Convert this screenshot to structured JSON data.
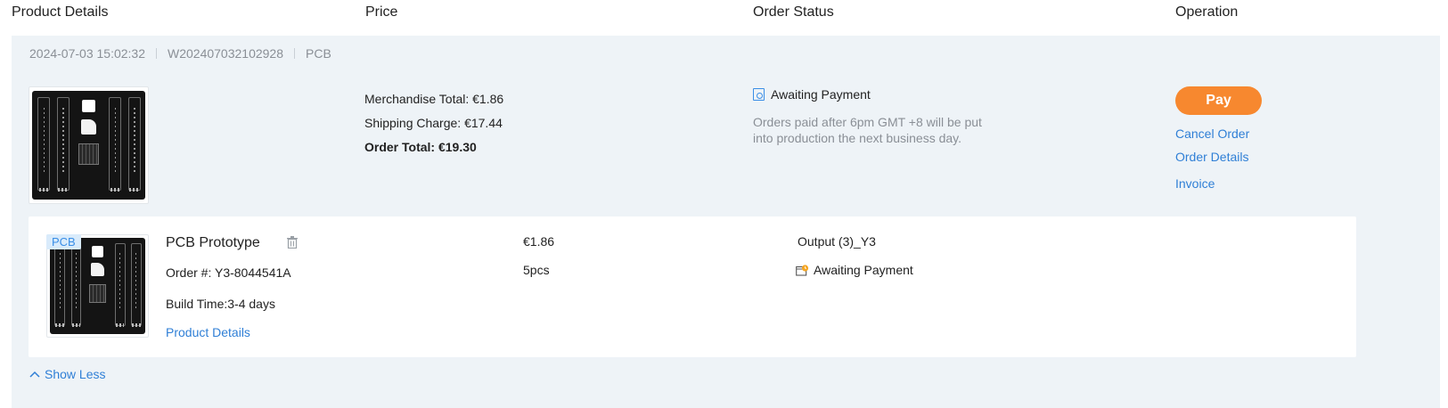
{
  "columns": {
    "product": "Product Details",
    "price": "Price",
    "status": "Order Status",
    "operation": "Operation"
  },
  "order": {
    "date": "2024-07-03 15:02:32",
    "order_no": "W202407032102928",
    "type": "PCB",
    "merchandise_total": "Merchandise Total: €1.86",
    "shipping_charge": "Shipping Charge: €17.44",
    "order_total": "Order Total: €19.30",
    "status": "Awaiting Payment",
    "status_note": "Orders paid after 6pm GMT +8 will be put into production the next business day.",
    "actions": {
      "pay": "Pay",
      "cancel": "Cancel Order",
      "details": "Order Details",
      "invoice": "Invoice"
    }
  },
  "item": {
    "tag": "PCB",
    "title": "PCB Prototype",
    "order_no": "Order #: Y3-8044541A",
    "build_time": "Build Time:3-4 days",
    "details_link": "Product Details",
    "price": "€1.86",
    "quantity": "5pcs",
    "output": "Output (3)_Y3",
    "status": "Awaiting Payment"
  },
  "toggle": {
    "show_less": "Show Less"
  },
  "colors": {
    "accent": "#f7882f",
    "link": "#2f7fd6",
    "card_bg": "#eef3f7"
  }
}
